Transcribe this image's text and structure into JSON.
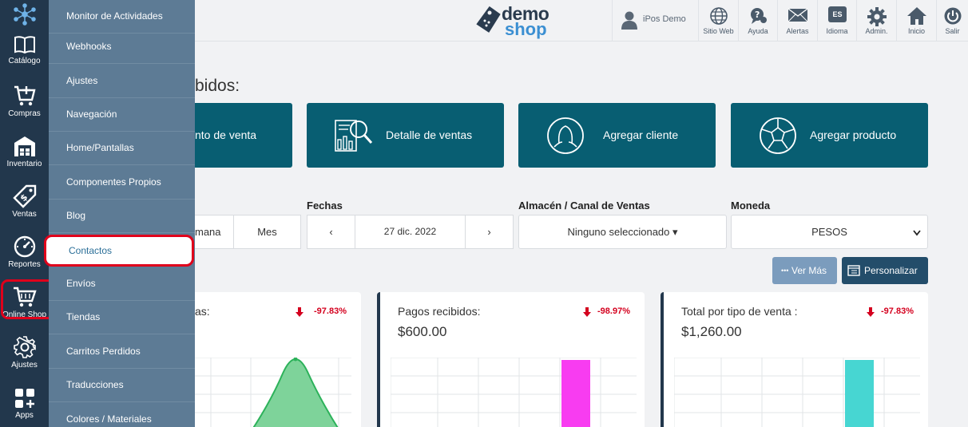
{
  "rail": {
    "items": [
      {
        "label": "",
        "icon": "network-icon"
      },
      {
        "label": "Catálogo",
        "icon": "book-icon"
      },
      {
        "label": "Compras",
        "icon": "cart-plus-icon"
      },
      {
        "label": "Inventario",
        "icon": "warehouse-icon"
      },
      {
        "label": "Ventas",
        "icon": "price-tag-icon"
      },
      {
        "label": "Reportes",
        "icon": "gauge-icon"
      },
      {
        "label": "Online Shop",
        "icon": "shopping-cart-icon"
      },
      {
        "label": "Ajustes",
        "icon": "gear-icon"
      },
      {
        "label": "Apps",
        "icon": "apps-icon"
      }
    ]
  },
  "submenu": {
    "items": [
      "Monitor de Actividades",
      "Webhooks",
      "Ajustes",
      "Navegación",
      "Home/Pantallas",
      "Componentes Propios",
      "Blog",
      "Contactos",
      "Envíos",
      "Tiendas",
      "Carritos Perdidos",
      "Traducciones",
      "Colores / Materiales"
    ],
    "active": "Contactos"
  },
  "header": {
    "logo_demo": "demo",
    "logo_shop": "shop",
    "user": "iPos Demo",
    "items": [
      {
        "label": "Sitio Web",
        "icon": "globe-icon"
      },
      {
        "label": "Ayuda",
        "icon": "help-chat-icon"
      },
      {
        "label": "Alertas",
        "icon": "envelope-icon"
      },
      {
        "label": "Idioma",
        "icon": "language-icon",
        "badge": "ES"
      },
      {
        "label": "Admin.",
        "icon": "gear-icon"
      },
      {
        "label": "Inicio",
        "icon": "home-icon"
      },
      {
        "label": "Salir",
        "icon": "power-icon"
      }
    ]
  },
  "main": {
    "heading_fragment": "bidos:",
    "quick_actions": [
      {
        "label": "nto de venta"
      },
      {
        "label": "Detalle de ventas",
        "icon": "sales-report-icon"
      },
      {
        "label": "Agregar cliente",
        "icon": "user-circle-icon"
      },
      {
        "label": "Agregar producto",
        "icon": "soccer-ball-icon"
      }
    ],
    "filters": {
      "period_labels": [
        "mana",
        "Mes"
      ],
      "dates_label": "Fechas",
      "date_value": "27 dic. 2022",
      "prev": "‹",
      "next": "›",
      "warehouse_label": "Almacén / Canal de Ventas",
      "warehouse_value": "Ninguno seleccionado ▾",
      "currency_label": "Moneda",
      "currency_value": "PESOS"
    },
    "buttons": {
      "ver_mas": "Ver Más",
      "personalizar": "Personalizar"
    },
    "cards": [
      {
        "title": "as:",
        "value": "",
        "pct": "-97.83%",
        "bar_color": "#2cb25a"
      },
      {
        "title": "Pagos recibidos:",
        "value": "$600.00",
        "pct": "-98.97%",
        "bar_color": "#f83cf1"
      },
      {
        "title": "Total por tipo de venta :",
        "value": "$1,260.00",
        "pct": "-97.83%",
        "bar_color": "#47d6d2"
      }
    ]
  },
  "colors": {
    "rail": "#22374c",
    "submenu": "#5d7b95",
    "teal": "#085e72",
    "highlight": "#e0001b",
    "down": "#d4001e"
  }
}
